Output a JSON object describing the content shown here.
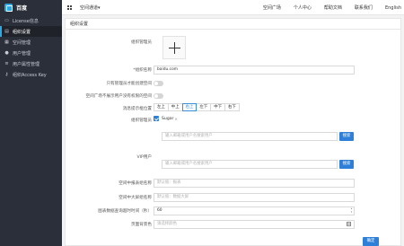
{
  "brand": {
    "name": "百度",
    "logo_icon": "cube-logo-icon",
    "accent": "#2ea8e5"
  },
  "sidebar": {
    "items": [
      {
        "label": "License信息",
        "icon": "monitor-icon",
        "active": false
      },
      {
        "label": "组织设置",
        "icon": "document-icon",
        "active": true
      },
      {
        "label": "空间管理",
        "icon": "grid-icon",
        "active": false
      },
      {
        "label": "用户管理",
        "icon": "user-icon",
        "active": false
      },
      {
        "label": "用户属性管理",
        "icon": "list-icon",
        "active": false
      },
      {
        "label": "组织Access Key",
        "icon": "key-icon",
        "active": false
      }
    ]
  },
  "topbar": {
    "space_switch": "空间通道▾",
    "links": [
      "空间广场",
      "个人中心",
      "帮助文档",
      "联系我们",
      "English"
    ]
  },
  "panel": {
    "title": "组织设置",
    "logo_label": "组织管理员",
    "name_label": "*组织名称",
    "name_value": "baidu.com",
    "admin_only_label": "只有管理员才能创建空间",
    "plaza_label": "空间广场不展示用户没有权限的空间",
    "msg_position_label": "消息提示框位置",
    "msg_positions": [
      "左上",
      "中上",
      "右上",
      "左下",
      "中下",
      "右下"
    ],
    "msg_position_selected": "右上",
    "admins_label": "组织管理员",
    "admin_tag": "Sugar",
    "admin_search_placeholder": "输入邮箱或用户名搜索用户",
    "search_button": "搜索",
    "vip_label": "VIP用户",
    "vip_search_placeholder": "输入邮箱或用户名搜索用户",
    "space_name_label": "空间中报表组名称",
    "space_name_placeholder": "默认值：报表",
    "bigscreen_name_label": "空间中大屏组名称",
    "bigscreen_name_placeholder": "默认值：数据大屏",
    "timeout_label": "图表数据查询超时时间（秒）",
    "timeout_value": "60",
    "bgcolor_label": "页面背景色",
    "bgcolor_placeholder": "请选择颜色",
    "confirm_button": "确定"
  },
  "colors": {
    "primary": "#2d7fd8",
    "sidebar_bg": "#2b2f3a"
  }
}
